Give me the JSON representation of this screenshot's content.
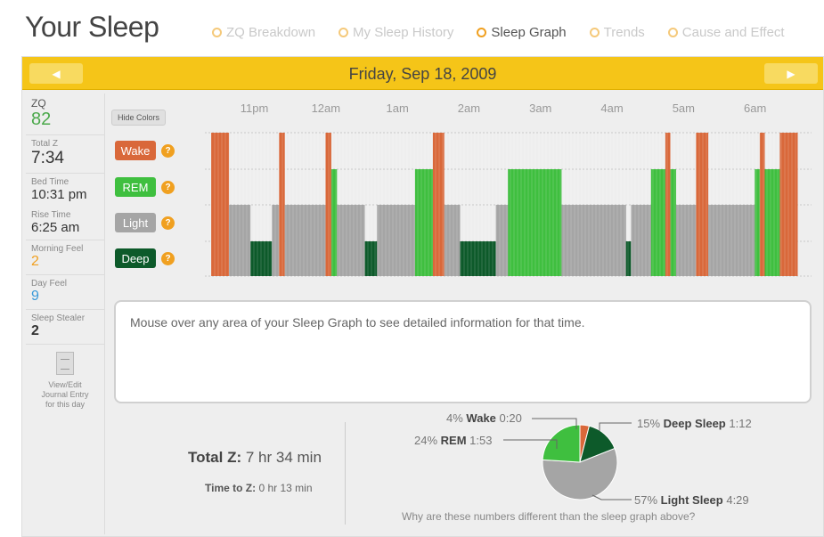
{
  "header": {
    "title": "Your Sleep",
    "nav": [
      {
        "label": "ZQ Breakdown",
        "active": false
      },
      {
        "label": "My Sleep History",
        "active": false
      },
      {
        "label": "Sleep Graph",
        "active": true
      },
      {
        "label": "Trends",
        "active": false
      },
      {
        "label": "Cause and Effect",
        "active": false
      }
    ]
  },
  "date_bar": {
    "date": "Friday, Sep 18, 2009",
    "prev_icon": "arrow-left-icon",
    "next_icon": "arrow-right-icon"
  },
  "sidebar": {
    "zq_label": "ZQ",
    "zq_value": "82",
    "total_z_label": "Total Z",
    "total_z_value": "7:34",
    "bed_time_label": "Bed Time",
    "bed_time_value": "10:31 pm",
    "rise_time_label": "Rise Time",
    "rise_time_value": "6:25 am",
    "morning_feel_label": "Morning Feel",
    "morning_feel_value": "2",
    "day_feel_label": "Day Feel",
    "day_feel_value": "9",
    "sleep_stealer_label": "Sleep Stealer",
    "sleep_stealer_value": "2",
    "journal_line1": "View/Edit",
    "journal_line2": "Journal Entry",
    "journal_line3": "for this day"
  },
  "graph": {
    "hide_colors_label": "Hide Colors",
    "help_glyph": "?",
    "time_labels": [
      "11pm",
      "12am",
      "1am",
      "2am",
      "3am",
      "4am",
      "5am",
      "6am"
    ],
    "stages": [
      {
        "key": "wake",
        "label": "Wake",
        "color": "#d9683a"
      },
      {
        "key": "rem",
        "label": "REM",
        "color": "#3fbf3f"
      },
      {
        "key": "light",
        "label": "Light",
        "color": "#a5a5a5"
      },
      {
        "key": "deep",
        "label": "Deep",
        "color": "#0d5a2a"
      }
    ]
  },
  "chart_data": [
    {
      "type": "bar",
      "title": "",
      "xlabel": "",
      "ylabel": "",
      "categories_y": [
        "Wake",
        "REM",
        "Light",
        "Deep"
      ],
      "x_ticks": [
        "11pm",
        "12am",
        "1am",
        "2am",
        "3am",
        "4am",
        "5am",
        "6am"
      ],
      "x_range_clock": [
        "10:31 pm",
        "6:25 am"
      ],
      "segments": [
        {
          "stage": "wake",
          "start": 0.0,
          "end": 0.25
        },
        {
          "stage": "light",
          "start": 0.25,
          "end": 0.55
        },
        {
          "stage": "deep",
          "start": 0.55,
          "end": 0.85
        },
        {
          "stage": "light",
          "start": 0.85,
          "end": 0.95
        },
        {
          "stage": "wake",
          "start": 0.95,
          "end": 1.03
        },
        {
          "stage": "light",
          "start": 1.03,
          "end": 1.6
        },
        {
          "stage": "wake",
          "start": 1.6,
          "end": 1.68
        },
        {
          "stage": "rem",
          "start": 1.68,
          "end": 1.76
        },
        {
          "stage": "light",
          "start": 1.76,
          "end": 2.15
        },
        {
          "stage": "deep",
          "start": 2.15,
          "end": 2.32
        },
        {
          "stage": "light",
          "start": 2.32,
          "end": 2.85
        },
        {
          "stage": "rem",
          "start": 2.85,
          "end": 3.1
        },
        {
          "stage": "wake",
          "start": 3.1,
          "end": 3.26
        },
        {
          "stage": "light",
          "start": 3.26,
          "end": 3.48
        },
        {
          "stage": "deep",
          "start": 3.48,
          "end": 3.98
        },
        {
          "stage": "light",
          "start": 3.98,
          "end": 4.15
        },
        {
          "stage": "rem",
          "start": 4.15,
          "end": 4.9
        },
        {
          "stage": "light",
          "start": 4.9,
          "end": 5.8
        },
        {
          "stage": "deep",
          "start": 5.8,
          "end": 5.87
        },
        {
          "stage": "light",
          "start": 5.87,
          "end": 6.15
        },
        {
          "stage": "rem",
          "start": 6.15,
          "end": 6.35
        },
        {
          "stage": "wake",
          "start": 6.35,
          "end": 6.42
        },
        {
          "stage": "rem",
          "start": 6.42,
          "end": 6.5
        },
        {
          "stage": "light",
          "start": 6.5,
          "end": 6.78
        },
        {
          "stage": "wake",
          "start": 6.78,
          "end": 6.95
        },
        {
          "stage": "light",
          "start": 6.95,
          "end": 7.6
        },
        {
          "stage": "rem",
          "start": 7.6,
          "end": 7.67
        },
        {
          "stage": "wake",
          "start": 7.67,
          "end": 7.74
        },
        {
          "stage": "rem",
          "start": 7.74,
          "end": 7.95
        },
        {
          "stage": "wake",
          "start": 7.95,
          "end": 8.2
        }
      ]
    },
    {
      "type": "pie",
      "title": "",
      "slices": [
        {
          "name": "Wake",
          "percent": 4,
          "duration": "0:20",
          "color": "#d9683a"
        },
        {
          "name": "Deep Sleep",
          "percent": 15,
          "duration": "1:12",
          "color": "#0d5a2a"
        },
        {
          "name": "Light Sleep",
          "percent": 57,
          "duration": "4:29",
          "color": "#a5a5a5"
        },
        {
          "name": "REM",
          "percent": 24,
          "duration": "1:53",
          "color": "#3fbf3f"
        }
      ]
    }
  ],
  "info_box": {
    "text": "Mouse over any area of your Sleep Graph to see detailed information for that time."
  },
  "summary": {
    "total_z_label": "Total Z:",
    "total_z_value": "7 hr 34 min",
    "time_to_z_label": "Time to Z:",
    "time_to_z_value": "0 hr 13 min"
  },
  "pie_labels": {
    "wake_pct": "4%",
    "wake_name": "Wake",
    "wake_dur": "0:20",
    "deep_pct": "15%",
    "deep_name": "Deep Sleep",
    "deep_dur": "1:12",
    "rem_pct": "24%",
    "rem_name": "REM",
    "rem_dur": "1:53",
    "light_pct": "57%",
    "light_name": "Light Sleep",
    "light_dur": "4:29",
    "why_text": "Why are these numbers different than the sleep graph above?"
  }
}
